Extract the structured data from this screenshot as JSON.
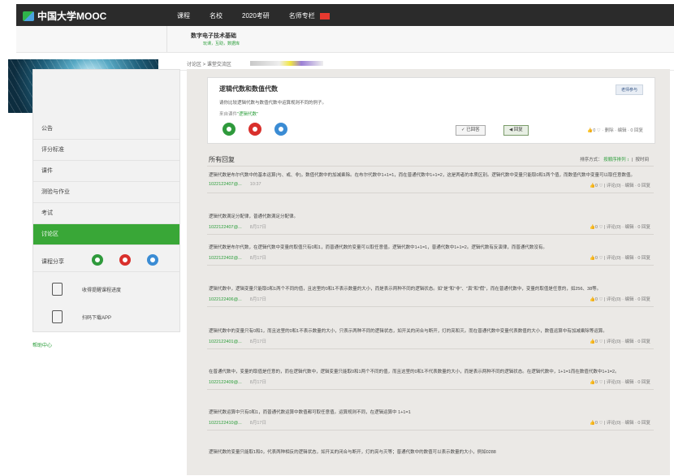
{
  "topbar": {
    "logo": "中国大学MOOC",
    "nav": [
      "课程",
      "名校",
      "2020考研",
      "名师专栏"
    ]
  },
  "course": {
    "title": "数字电子技术基础",
    "subtitle": "玩课，互助，数据库"
  },
  "breadcrumb": {
    "label": "讨论区  >  课堂交流区"
  },
  "sidebar": {
    "menu": [
      "公告",
      "评分标准",
      "课件",
      "测验与作业",
      "考试",
      "讨论区"
    ],
    "active_index": 5,
    "share_label": "课程分享",
    "share_colors": [
      "#2f9a3c",
      "#d9302c",
      "#3b8cd4"
    ],
    "links": [
      "收得提醒课程进度",
      "扫码下载APP"
    ],
    "help": "帮助中心"
  },
  "question": {
    "title": "逻辑代数和数值代数",
    "description": "请你比较逻辑代数与数值代数中运算规则不同的例子。",
    "link_prefix": "来自课件",
    "link_text": "\"逻辑代数\"",
    "tag": "老师参与",
    "circle_colors": [
      "#2f9a3c",
      "#d9302c",
      "#3b8cd4"
    ],
    "btn_reply": "✓ 已回答",
    "btn_back": "◀ 回复",
    "meta": "👍0 ♡  ·  删除  ·  编辑  ·  0 回复"
  },
  "list": {
    "title": "所有回复",
    "sort_label": "排序方式：",
    "sort_active": "按顺序排列 ↕",
    "sort_other": "按时间"
  },
  "posts": [
    {
      "text": "逻辑代数是布尔代数中的基本运算(与、或、非)，数值代数中的加减乘除。在布尔代数中1+1=1，而在普通代数中1+1=2，这是两者的本质区别。逻辑代数中变量只能取0和1两个值，而数值代数中变量可以取任意数值。",
      "author": "1022122407@...",
      "time": "10:37",
      "stats": "👍0 ♡  |  评论(0)  ·  编辑  ·  0 回复"
    },
    {
      "text": "逻辑代数满足分配律，普通代数满足分配律。",
      "author": "1022122407@...",
      "time": "8月17日",
      "stats": "👍0 ♡  |  评论(0)  ·  编辑  ·  0 回复"
    },
    {
      "text": "逻辑代数是布尔代数，在逻辑代数中变量的取值只有0和1，而普通代数的变量可以取任意值。逻辑代数中1+1=1，普通代数中1+1=2。逻辑代数有反演律，而普通代数没有。",
      "author": "1022122402@...",
      "time": "8月17日",
      "stats": "👍0 ♡  |  评论(0)  ·  编辑  ·  0 回复"
    },
    {
      "text": "逻辑代数中，逻辑变量只能取0和1两个不同的值，且这里的0和1不表示数量的大小，而是表示两种不同的逻辑状态。如\"是\"和\"非\"、\"真\"和\"假\"，而在普通代数中，变量的取值是任意的，如256、38等。",
      "author": "1022122406@...",
      "time": "8月17日",
      "stats": "👍0 ♡  |  评论(0)  ·  编辑  ·  0 回复"
    },
    {
      "text": "逻辑代数中的变量只有0和1，而且这里的0和1不表示数量的大小，只表示两种不同的逻辑状态，如开关的闭合与断开，灯的亮和灭。而在普通代数中变量代表数值的大小，数值运算中有加减乘除等运算。",
      "author": "1022122401@...",
      "time": "8月17日",
      "stats": "👍0 ♡  |  评论(0)  ·  编辑  ·  0 回复"
    },
    {
      "text": "在普通代数中，变量的取值是任意的，而在逻辑代数中，逻辑变量只能取0和1两个不同的值，而且这里的0和1不代表数量的大小，而是表示两种不同的逻辑状态。在逻辑代数中，1+1=1而在数值代数中1+1=2。",
      "author": "1022122409@...",
      "time": "8月17日",
      "stats": "👍0 ♡  |  评论(0)  ·  编辑  ·  0 回复"
    },
    {
      "text": "逻辑代数运算中只有0和1，而普通代数运算中数值都可取任意值。运算规则不同，在逻辑运算中 1+1=1",
      "author": "1022122410@...",
      "time": "8月17日",
      "stats": "👍0 ♡  |  评论(0)  ·  编辑  ·  0 回复"
    },
    {
      "text": "逻辑代数的变量只能取1和0，代表两种相反的逻辑状态，如开关的闭合与断开，灯的亮与灭等；普通代数中的数值可以表示数量的大小，例如0288",
      "author": "",
      "time": "",
      "stats": ""
    }
  ]
}
